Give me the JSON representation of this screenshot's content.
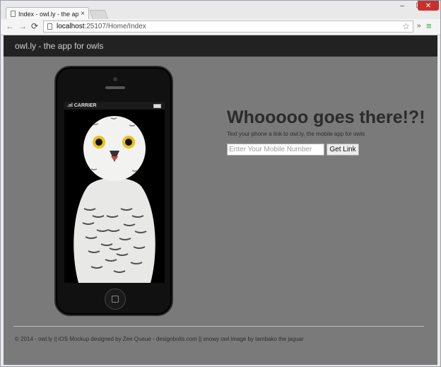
{
  "browser": {
    "tab_title": "Index - owl.ly - the app for owls",
    "tab_close": "×",
    "window_controls": {
      "minimize": "‒",
      "maximize": "☐",
      "close": "✕"
    },
    "nav": {
      "back": "←",
      "forward": "→",
      "reload": "⟳"
    },
    "address": {
      "host": "localhost",
      "rest": ":25107/Home/Index"
    },
    "star": "☆",
    "extensions": "»",
    "menu": "≡"
  },
  "site": {
    "brand": "owl.ly - the app for owls"
  },
  "phone": {
    "carrier": ".ııl CARRIER"
  },
  "hero": {
    "title": "Whooooo goes there!?!",
    "subtitle": "Text your phone a link to owl.ly, the mobile app for owls",
    "input_placeholder": "Enter Your Mobile Number",
    "button_label": "Get Link"
  },
  "footer": {
    "text": "© 2014 - owl.ly || iOS Mockup designed by Zee Queue - designbolts.com || snowy owl image by tambako the jaguar"
  }
}
